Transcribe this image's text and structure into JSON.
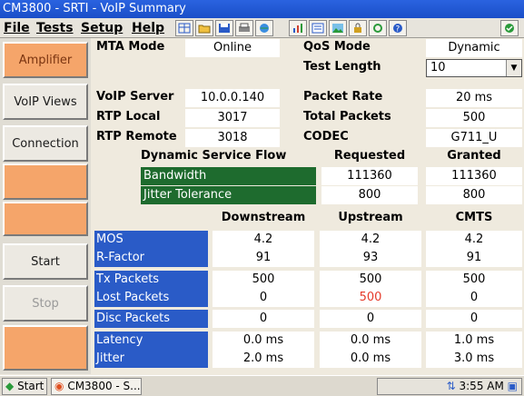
{
  "window": {
    "title": "CM3800 - SRTI - VoIP Summary"
  },
  "menu": [
    {
      "label": "File"
    },
    {
      "label": "Tests"
    },
    {
      "label": "Setup"
    },
    {
      "label": "Help"
    }
  ],
  "sidebar": {
    "items": [
      {
        "label": "Amplifier"
      },
      {
        "label": "VoIP Views"
      },
      {
        "label": "Connection"
      },
      {
        "label": ""
      },
      {
        "label": ""
      },
      {
        "label": "Start"
      },
      {
        "label": "Stop"
      },
      {
        "label": ""
      }
    ]
  },
  "summary": {
    "mta_mode_label": "MTA Mode",
    "mta_mode": "Online",
    "qos_mode_label": "QoS Mode",
    "qos_mode": "Dynamic",
    "test_length_label": "Test Length",
    "test_length": "10",
    "voip_server_label": "VoIP Server",
    "voip_server": "10.0.0.140",
    "packet_rate_label": "Packet Rate",
    "packet_rate": "20 ms",
    "rtp_local_label": "RTP Local",
    "rtp_local": "3017",
    "total_packets_label": "Total Packets",
    "total_packets": "500",
    "rtp_remote_label": "RTP Remote",
    "rtp_remote": "3018",
    "codec_label": "CODEC",
    "codec": "G711_U"
  },
  "dsf": {
    "title": "Dynamic Service Flow",
    "requested_header": "Requested",
    "granted_header": "Granted",
    "rows": [
      {
        "label": "Bandwidth",
        "requested": "111360",
        "granted": "111360"
      },
      {
        "label": "Jitter Tolerance",
        "requested": "800",
        "granted": "800"
      }
    ]
  },
  "stats": {
    "headers": [
      "Downstream",
      "Upstream",
      "CMTS"
    ],
    "rows": [
      {
        "label": "MOS",
        "down": "4.2",
        "up": "4.2",
        "cmts": "4.2"
      },
      {
        "label": "R-Factor",
        "down": "91",
        "up": "93",
        "cmts": "91"
      },
      {
        "label": "Tx Packets",
        "down": "500",
        "up": "500",
        "cmts": "500"
      },
      {
        "label": "Lost Packets",
        "down": "0",
        "up": "500",
        "cmts": "0"
      },
      {
        "label": "Disc Packets",
        "down": "0",
        "up": "0",
        "cmts": "0"
      },
      {
        "label": "Latency",
        "down": "0.0 ms",
        "up": "0.0 ms",
        "cmts": "1.0 ms"
      },
      {
        "label": "Jitter",
        "down": "2.0 ms",
        "up": "0.0 ms",
        "cmts": "3.0 ms"
      }
    ],
    "highlight_color": "#e53a2a"
  },
  "taskbar": {
    "start": "Start",
    "task": "CM3800 - S...",
    "time": "3:55 AM"
  }
}
